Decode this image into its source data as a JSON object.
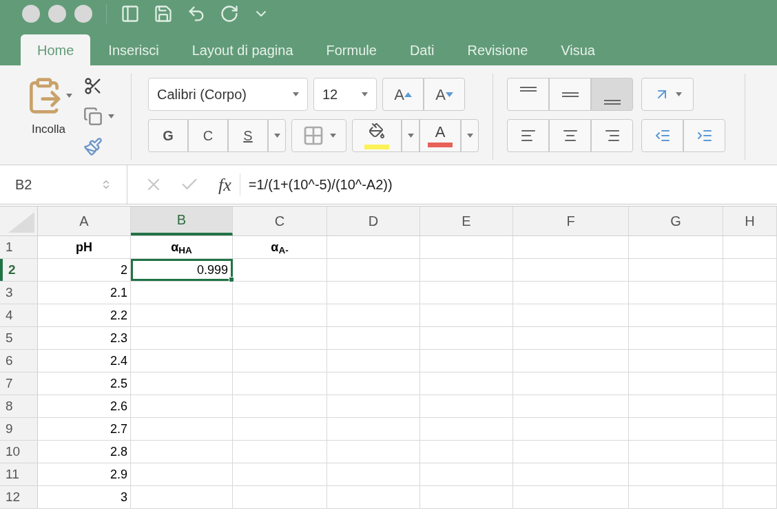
{
  "tabs": [
    {
      "label": "Home",
      "selected": true
    },
    {
      "label": "Inserisci",
      "selected": false
    },
    {
      "label": "Layout di pagina",
      "selected": false
    },
    {
      "label": "Formule",
      "selected": false
    },
    {
      "label": "Dati",
      "selected": false
    },
    {
      "label": "Revisione",
      "selected": false
    },
    {
      "label": "Visua",
      "selected": false
    }
  ],
  "ribbon": {
    "paste_label": "Incolla",
    "font_name": "Calibri (Corpo)",
    "font_size": "12",
    "size_buttons": [
      "A",
      "A"
    ],
    "style_buttons": [
      "G",
      "C",
      "S"
    ],
    "font_color_button": "A",
    "vertical_align": [
      {
        "selected": false
      },
      {
        "selected": false
      },
      {
        "selected": true
      }
    ]
  },
  "formula_bar": {
    "name_box": "B2",
    "function_label": "fx",
    "formula": "=1/(1+(10^-5)/(10^-A2))"
  },
  "sheet": {
    "columns": [
      {
        "label": "A",
        "selected": false
      },
      {
        "label": "B",
        "selected": true
      },
      {
        "label": "C",
        "selected": false
      },
      {
        "label": "D",
        "selected": false
      },
      {
        "label": "E",
        "selected": false
      },
      {
        "label": "F",
        "selected": false
      },
      {
        "label": "G",
        "selected": false
      },
      {
        "label": "H",
        "selected": false
      }
    ],
    "rows": [
      {
        "label": "1",
        "selected": false,
        "kind": "header",
        "cells": [
          {
            "text": "pH",
            "selected": false
          },
          {
            "text": "α$_{HA}$",
            "selected": false
          },
          {
            "text": "α$_{A-}$",
            "selected": false
          }
        ]
      },
      {
        "label": "2",
        "selected": true,
        "kind": "data",
        "cells": [
          {
            "text": "2",
            "selected": false
          },
          {
            "text": "0.999",
            "selected": true
          }
        ]
      },
      {
        "label": "3",
        "selected": false,
        "kind": "data",
        "cells": [
          {
            "text": "2.1",
            "selected": false
          }
        ]
      },
      {
        "label": "4",
        "selected": false,
        "kind": "data",
        "cells": [
          {
            "text": "2.2",
            "selected": false
          }
        ]
      },
      {
        "label": "5",
        "selected": false,
        "kind": "data",
        "cells": [
          {
            "text": "2.3",
            "selected": false
          }
        ]
      },
      {
        "label": "6",
        "selected": false,
        "kind": "data",
        "cells": [
          {
            "text": "2.4",
            "selected": false
          }
        ]
      },
      {
        "label": "7",
        "selected": false,
        "kind": "data",
        "cells": [
          {
            "text": "2.5",
            "selected": false
          }
        ]
      },
      {
        "label": "8",
        "selected": false,
        "kind": "data",
        "cells": [
          {
            "text": "2.6",
            "selected": false
          }
        ]
      },
      {
        "label": "9",
        "selected": false,
        "kind": "data",
        "cells": [
          {
            "text": "2.7",
            "selected": false
          }
        ]
      },
      {
        "label": "10",
        "selected": false,
        "kind": "data",
        "cells": [
          {
            "text": "2.8",
            "selected": false
          }
        ]
      },
      {
        "label": "11",
        "selected": false,
        "kind": "data",
        "cells": [
          {
            "text": "2.9",
            "selected": false
          }
        ]
      },
      {
        "label": "12",
        "selected": false,
        "kind": "data",
        "cells": [
          {
            "text": "3",
            "selected": false
          }
        ]
      }
    ]
  }
}
